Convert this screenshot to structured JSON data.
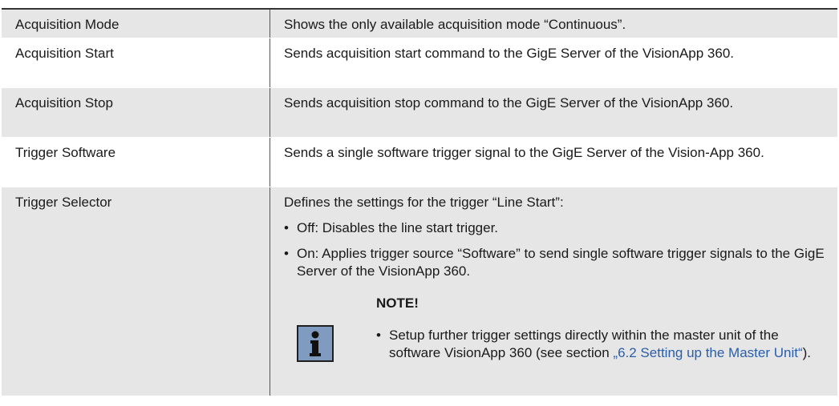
{
  "rows": [
    {
      "name": "Acquisition Mode",
      "desc": "Shows the only available acquisition mode “Continuous”."
    },
    {
      "name": "Acquisition Start",
      "desc": "Sends acquisition start command to the GigE Server of the VisionApp 360."
    },
    {
      "name": "Acquisition Stop",
      "desc": "Sends acquisition stop command to the GigE Server of the VisionApp 360."
    },
    {
      "name": "Trigger Software",
      "desc": "Sends a single software trigger signal to the GigE Server of the Vision-App 360."
    },
    {
      "name": "Trigger Selector",
      "desc": "Defines the settings for the trigger “Line Start”:"
    }
  ],
  "trigger_selector": {
    "bullets": [
      "Off: Disables the line start trigger.",
      "On: Applies trigger source “Software” to send single software trigger signals to the GigE Server of the VisionApp 360."
    ],
    "note": {
      "title": "NOTE!",
      "icon": "info-icon",
      "text_before": "Setup further trigger settings directly within the master unit of the software VisionApp 360 (see section ",
      "link": "„6.2 Setting up the Master Unit“",
      "text_after": ")."
    }
  },
  "colors": {
    "alt_row": "#e6e6e6",
    "icon_bg": "#7f9bbf",
    "link": "#2a5ea8"
  }
}
